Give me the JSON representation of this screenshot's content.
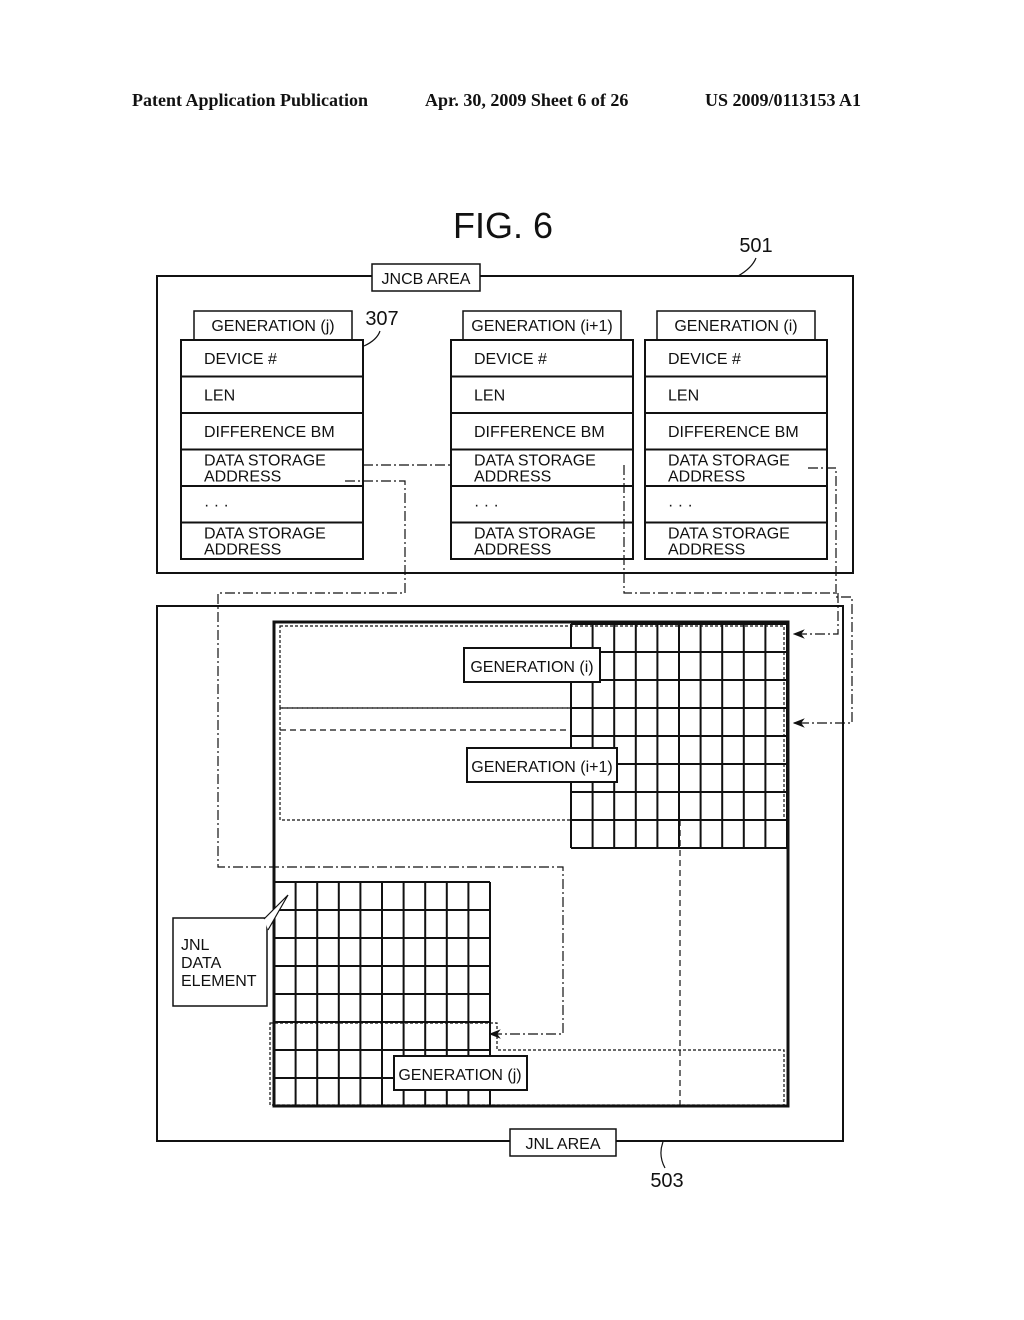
{
  "header": {
    "publication": "Patent Application Publication",
    "date_sheet": "Apr. 30, 2009  Sheet 6 of 26",
    "patent_number": "US 2009/0113153 A1"
  },
  "figure": {
    "title": "FIG. 6",
    "jncb_area": {
      "label": "JNCB AREA",
      "ref": "501"
    },
    "jnl_area": {
      "label": "JNL AREA",
      "ref": "503"
    },
    "control_block_ref": "307",
    "control_blocks": [
      {
        "generation": "GENERATION (j)",
        "fields": [
          "DEVICE #",
          "LEN",
          "DIFFERENCE BM",
          "DATA STORAGE|ADDRESS",
          "· · ·",
          "DATA STORAGE|ADDRESS"
        ]
      },
      {
        "generation": "GENERATION (i+1)",
        "fields": [
          "DEVICE #",
          "LEN",
          "DIFFERENCE BM",
          "DATA STORAGE|ADDRESS",
          "· · ·",
          "DATA STORAGE|ADDRESS"
        ]
      },
      {
        "generation": "GENERATION (i)",
        "fields": [
          "DEVICE #",
          "LEN",
          "DIFFERENCE BM",
          "DATA STORAGE|ADDRESS",
          "· · ·",
          "DATA STORAGE|ADDRESS"
        ]
      }
    ],
    "jnl_labels": {
      "gen_i": "GENERATION (i)",
      "gen_i1": "GENERATION (i+1)",
      "gen_j": "GENERATION (j)",
      "data_element": [
        "JNL",
        "DATA",
        "ELEMENT"
      ]
    }
  }
}
